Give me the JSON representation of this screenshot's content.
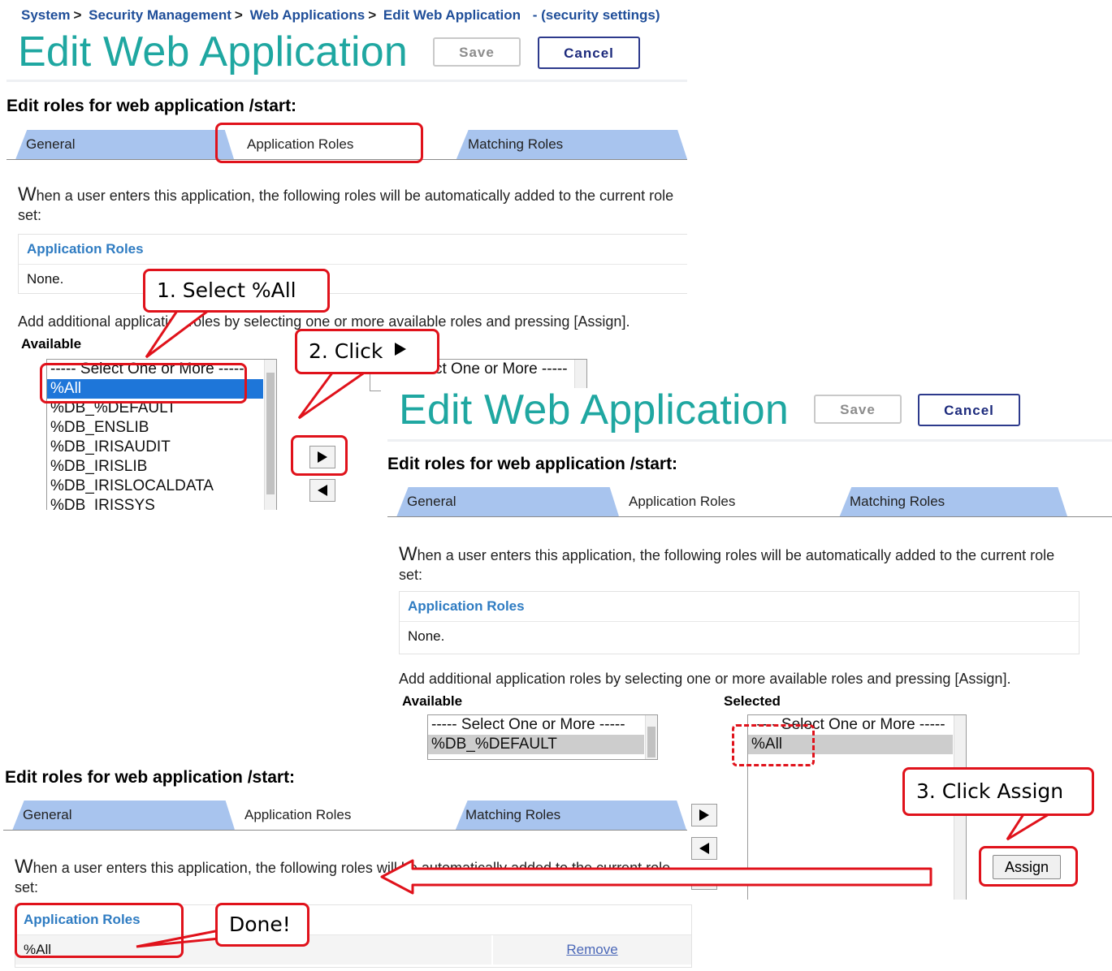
{
  "breadcrumb": {
    "items": [
      "System",
      "Security Management",
      "Web Applications",
      "Edit Web Application"
    ],
    "separator": ">",
    "suffix": "- (security settings)"
  },
  "page": {
    "title": "Edit Web Application",
    "save_label": "Save",
    "cancel_label": "Cancel",
    "heading": "Edit roles for web application /start:"
  },
  "tabs": [
    "General",
    "Application Roles",
    "Matching Roles"
  ],
  "intro": {
    "first_letter": "W",
    "rest": "hen a user enters this application, the following roles will be automatically added to the current role set:"
  },
  "roles_table": {
    "header": "Application Roles",
    "empty_text": "None.",
    "row_value": "%All",
    "row_action": "Remove"
  },
  "assign_section": {
    "text": "Add additional application roles by selecting one or more available roles and pressing [Assign].",
    "available_label": "Available",
    "selected_label": "Selected",
    "placeholder": "----- Select One or More -----",
    "assign_label": "Assign"
  },
  "available_roles": [
    "%All",
    "%DB_%DEFAULT",
    "%DB_ENSLIB",
    "%DB_IRISAUDIT",
    "%DB_IRISLIB",
    "%DB_IRISLOCALDATA",
    "%DB_IRISSYS"
  ],
  "available_after": [
    "%DB_%DEFAULT"
  ],
  "selected_roles": [
    "%All"
  ],
  "callouts": {
    "step1": "1.  Select %All",
    "step2": "2.  Click",
    "step2_icon": "right-triangle-icon",
    "step3": "3.  Click Assign",
    "done": "Done!"
  },
  "colors": {
    "title": "#1fa7a1",
    "tab_active": "#a8c4ee",
    "callout": "#e0121b",
    "link": "#2f7cc2",
    "selection": "#1e76d9"
  }
}
